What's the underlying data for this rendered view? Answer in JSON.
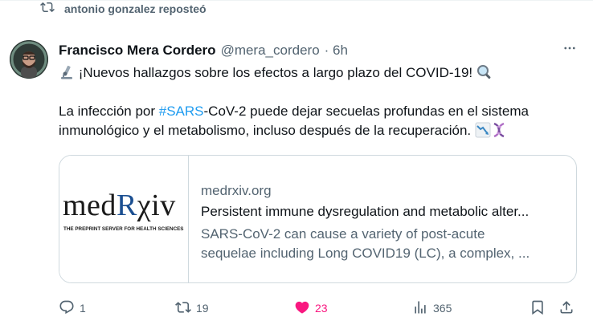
{
  "repost": {
    "text": "antonio gonzalez reposteó",
    "icon": "repost-icon"
  },
  "tweet": {
    "author_name": "Francisco Mera Cordero",
    "handle": "@mera_cordero",
    "time": "· 6h",
    "line1": " ¡Nuevos hallazgos sobre los efectos a largo plazo del COVID-19! ",
    "line2_prefix": "La infección por  ",
    "hashtag": "#SARS",
    "line2_suffix": "-CoV-2 puede dejar secuelas profundas en el sistema",
    "line3": "inmunológico y el metabolismo, incluso después de la recuperación. ",
    "emojis": [
      "microscope-emoji",
      "magnifier-emoji",
      "chart-decreasing-emoji",
      "dna-emoji"
    ]
  },
  "card": {
    "logo_text_left": "med",
    "logo_text_r": "R",
    "logo_text_right": "χiv",
    "logo_subtitle": "THE PREPRINT SERVER FOR HEALTH SCIENCES",
    "domain": "medrxiv.org",
    "title": "Persistent immune dysregulation and metabolic alter...",
    "desc_line1": "SARS-CoV-2 can cause a variety of post-acute",
    "desc_line2": "sequelae including Long COVID19 (LC), a complex, ..."
  },
  "actions": {
    "replies": "1",
    "reposts": "19",
    "likes": "23",
    "views": "365",
    "liked_color": "#f91880",
    "muted_color": "#536471"
  }
}
